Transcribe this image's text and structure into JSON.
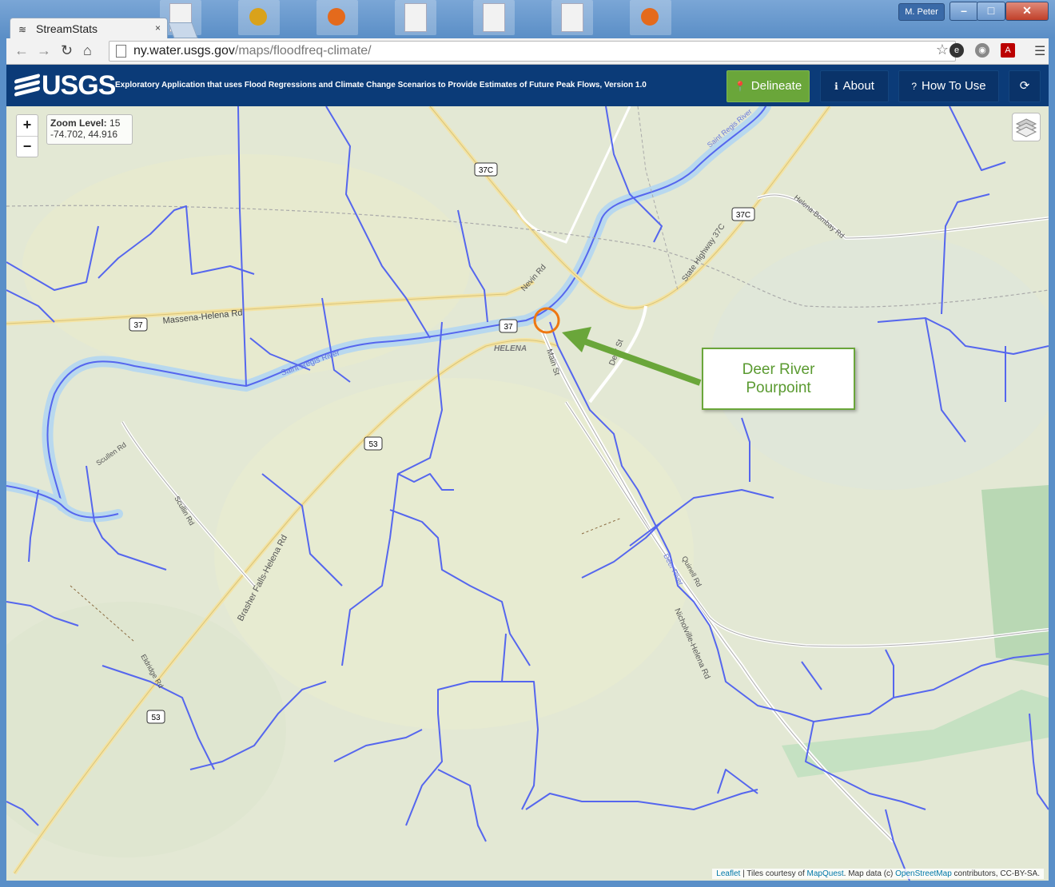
{
  "window": {
    "user": "M. Peter",
    "min_icon": "minimize-icon",
    "max_icon": "maximize-icon",
    "close_icon": "close-icon"
  },
  "tab": {
    "title": "StreamStats",
    "close": "×"
  },
  "toolbar": {
    "url_host": "ny.water.usgs.gov",
    "url_path": "/maps/floodfreq-climate/"
  },
  "header": {
    "logo_text": "USGS",
    "subtitle": "Exploratory Application that uses Flood Regressions and Climate Change Scenarios to Provide Estimates of Future Peak Flows, Version 1.0",
    "buttons": {
      "delineate": "Delineate",
      "about": "About",
      "how_to_use": "How To Use"
    }
  },
  "map": {
    "zoom_in": "+",
    "zoom_out": "−",
    "zoom_label": "Zoom Level:",
    "zoom_value": "15",
    "coords": "-74.702, 44.916",
    "annotation_line1": "Deer River",
    "annotation_line2": "Pourpoint",
    "labels": {
      "r37c_a": "37C",
      "r37c_b": "37C",
      "r37_a": "37",
      "r37_b": "37",
      "r53_a": "53",
      "r53_b": "53",
      "massena": "Massena-Helena Rd",
      "helena": "HELENA",
      "nevin": "Nevin Rd",
      "main_st": "Main St",
      "deer_st": "Deer St",
      "state_hwy": "State Highway 37C",
      "helena_bombay": "Helena-Bombay Rd",
      "saint_regis_a": "Saint Regis River",
      "saint_regis_b": "Saint Regis River",
      "scullen_a": "Scullen Rd",
      "scullen_b": "Scullin Rd",
      "brasher": "Brasher Falls-Helena Rd",
      "eldridge": "Eldridge Rd",
      "quinell": "Quinell Rd",
      "deer_river": "Deer River",
      "nicholville": "Nicholville-Helena Rd"
    },
    "attribution": {
      "leaflet": "Leaflet",
      "tiles": "| Tiles courtesy of",
      "mapquest": "MapQuest",
      "mapdata": ". Map data (c)",
      "osm": "OpenStreetMap",
      "rest": "contributors, CC-BY-SA."
    }
  },
  "colors": {
    "header_bg": "#0b3b78",
    "delineate_bg": "#6aa63a",
    "stream": "#5566ee",
    "river_fill": "#b8d8ee",
    "pourpoint": "#ee7711",
    "arrow": "#6aa63a"
  }
}
